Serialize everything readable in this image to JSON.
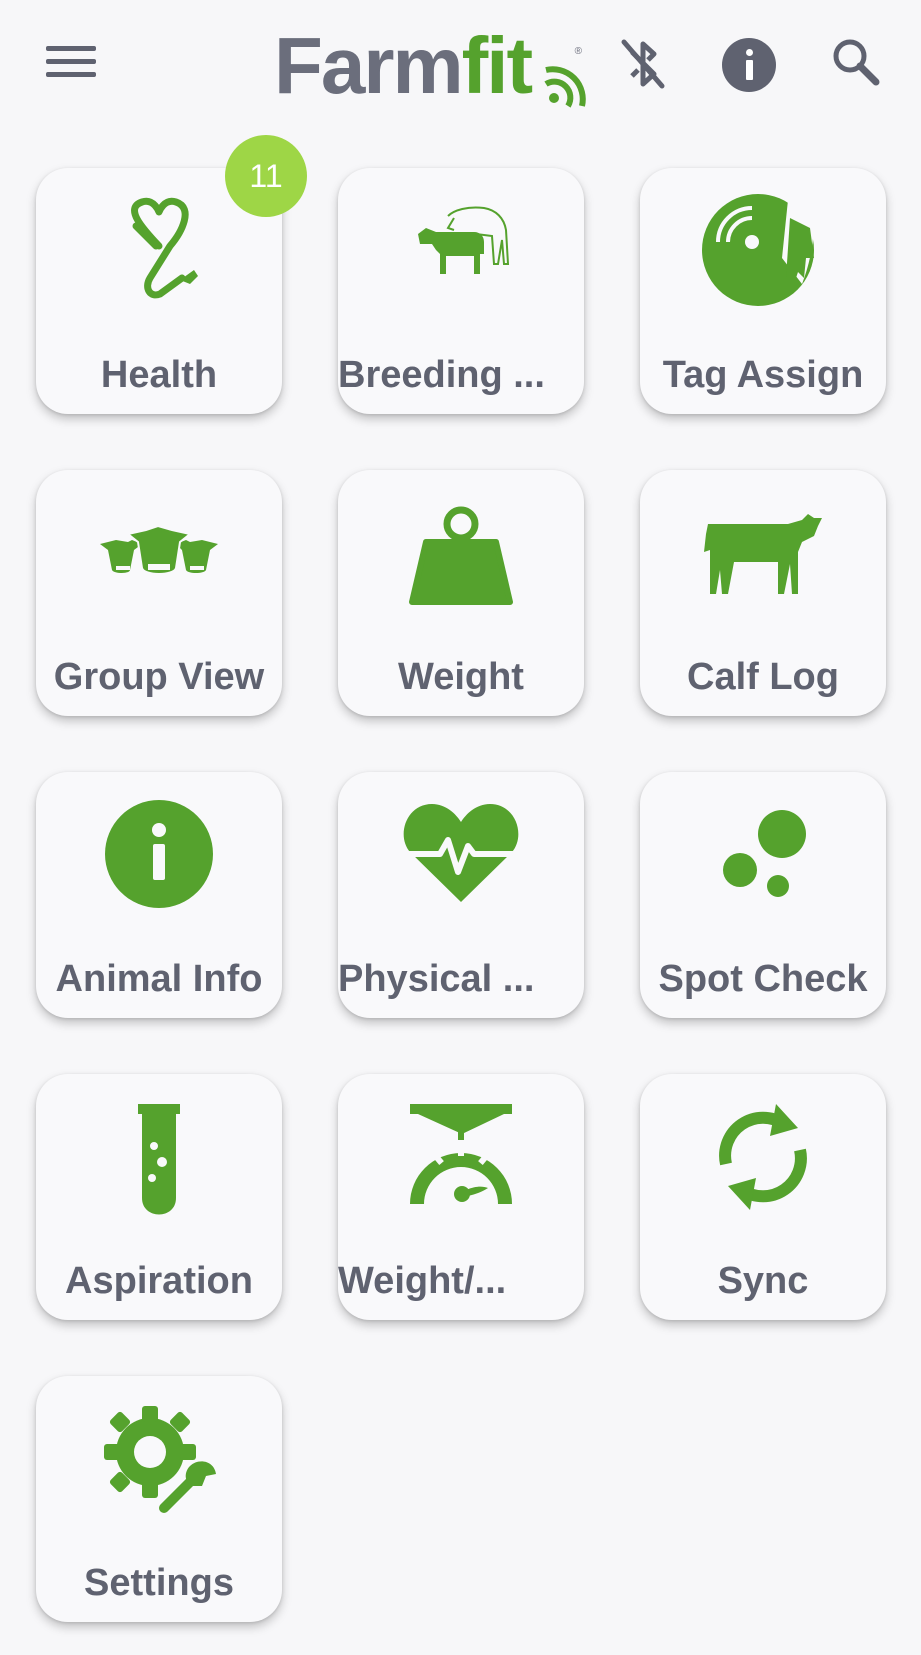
{
  "header": {
    "menu_icon": "hamburger-icon",
    "logo": {
      "part1": "Farm",
      "part2": "fit",
      "reg": "®"
    },
    "bluetooth_icon": "bluetooth-disabled-icon",
    "info_icon": "info-icon",
    "search_icon": "search-icon"
  },
  "colors": {
    "accent": "#55a22d",
    "text": "#5f6270",
    "badge": "#9ed646",
    "background": "#f7f7f9"
  },
  "tiles": [
    {
      "label": "Health",
      "icon": "heart-stethoscope-icon",
      "badge": "11"
    },
    {
      "label": "Breeding ...",
      "icon": "breeding-cows-icon"
    },
    {
      "label": "Tag Assign",
      "icon": "tag-scanner-icon"
    },
    {
      "label": "Group View",
      "icon": "cow-group-icon"
    },
    {
      "label": "Weight",
      "icon": "weight-icon"
    },
    {
      "label": "Calf Log",
      "icon": "calf-icon"
    },
    {
      "label": "Animal Info",
      "icon": "info-circle-icon"
    },
    {
      "label": "Physical ...",
      "icon": "heart-pulse-icon"
    },
    {
      "label": "Spot Check",
      "icon": "spot-dots-icon"
    },
    {
      "label": "Aspiration",
      "icon": "test-tube-icon"
    },
    {
      "label": "Weight/...",
      "icon": "scale-gauge-icon"
    },
    {
      "label": "Sync",
      "icon": "sync-icon"
    },
    {
      "label": "Settings",
      "icon": "gear-wrench-icon"
    }
  ]
}
